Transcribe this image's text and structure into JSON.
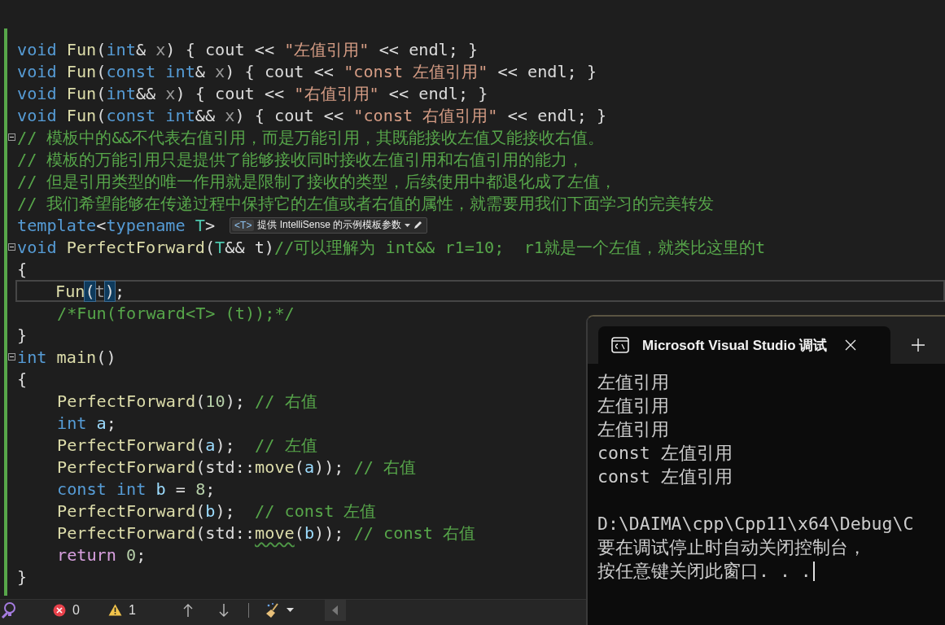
{
  "editor": {
    "lines": [
      {
        "indent": false,
        "fold": false,
        "current": false,
        "tokens": [
          {
            "kind": "kw",
            "text": "void"
          },
          {
            "kind": "func",
            "text": " Fun"
          },
          {
            "kind": "plain",
            "text": "("
          },
          {
            "kind": "kw",
            "text": "int"
          },
          {
            "kind": "plain",
            "text": "& "
          },
          {
            "kind": "unused",
            "text": "x"
          },
          {
            "kind": "plain",
            "text": ") { cout << "
          },
          {
            "kind": "string",
            "text": "\"左值引用\""
          },
          {
            "kind": "plain",
            "text": " << endl; }"
          }
        ]
      },
      {
        "indent": false,
        "fold": false,
        "current": false,
        "tokens": [
          {
            "kind": "kw",
            "text": "void"
          },
          {
            "kind": "func",
            "text": " Fun"
          },
          {
            "kind": "plain",
            "text": "("
          },
          {
            "kind": "kw",
            "text": "const int"
          },
          {
            "kind": "plain",
            "text": "& "
          },
          {
            "kind": "unused",
            "text": "x"
          },
          {
            "kind": "plain",
            "text": ") { cout << "
          },
          {
            "kind": "string",
            "text": "\"const 左值引用\""
          },
          {
            "kind": "plain",
            "text": " << endl; }"
          }
        ]
      },
      {
        "indent": false,
        "fold": false,
        "current": false,
        "tokens": [
          {
            "kind": "kw",
            "text": "void"
          },
          {
            "kind": "func",
            "text": " Fun"
          },
          {
            "kind": "plain",
            "text": "("
          },
          {
            "kind": "kw",
            "text": "int"
          },
          {
            "kind": "plain",
            "text": "&& "
          },
          {
            "kind": "unused",
            "text": "x"
          },
          {
            "kind": "plain",
            "text": ") { cout << "
          },
          {
            "kind": "string",
            "text": "\"右值引用\""
          },
          {
            "kind": "plain",
            "text": " << endl; }"
          }
        ]
      },
      {
        "indent": false,
        "fold": false,
        "current": false,
        "tokens": [
          {
            "kind": "kw",
            "text": "void"
          },
          {
            "kind": "func",
            "text": " Fun"
          },
          {
            "kind": "plain",
            "text": "("
          },
          {
            "kind": "kw",
            "text": "const int"
          },
          {
            "kind": "plain",
            "text": "&& "
          },
          {
            "kind": "unused",
            "text": "x"
          },
          {
            "kind": "plain",
            "text": ") { cout << "
          },
          {
            "kind": "string",
            "text": "\"const 右值引用\""
          },
          {
            "kind": "plain",
            "text": " << endl; }"
          }
        ]
      },
      {
        "indent": false,
        "fold": true,
        "current": false,
        "tokens": [
          {
            "kind": "comment",
            "text": "// 模板中的&&不代表右值引用，而是万能引用，其既能接收左值又能接收右值。"
          }
        ]
      },
      {
        "indent": false,
        "fold": false,
        "current": false,
        "tokens": [
          {
            "kind": "comment",
            "text": "// 模板的万能引用只是提供了能够接收同时接收左值引用和右值引用的能力，"
          }
        ]
      },
      {
        "indent": false,
        "fold": false,
        "current": false,
        "tokens": [
          {
            "kind": "comment",
            "text": "// 但是引用类型的唯一作用就是限制了接收的类型，后续使用中都退化成了左值，"
          }
        ]
      },
      {
        "indent": false,
        "fold": false,
        "current": false,
        "tokens": [
          {
            "kind": "comment",
            "text": "// 我们希望能够在传递过程中保持它的左值或者右值的属性，就需要用我们下面学习的完美转发"
          }
        ]
      },
      {
        "indent": false,
        "fold": false,
        "current": false,
        "tokens": [
          {
            "kind": "kw",
            "text": "template"
          },
          {
            "kind": "plain",
            "text": "<"
          },
          {
            "kind": "kw",
            "text": "typename"
          },
          {
            "kind": "type",
            "text": " T"
          },
          {
            "kind": "plain",
            "text": ">"
          }
        ],
        "hint": {
          "tag": "<T>",
          "text": "提供 IntelliSense 的示例模板参数"
        }
      },
      {
        "indent": false,
        "fold": true,
        "current": false,
        "tokens": [
          {
            "kind": "kw",
            "text": "void"
          },
          {
            "kind": "func",
            "text": " PerfectForward"
          },
          {
            "kind": "plain",
            "text": "("
          },
          {
            "kind": "type",
            "text": "T"
          },
          {
            "kind": "plain",
            "text": "&& t)"
          },
          {
            "kind": "comment",
            "text": "//可以理解为 int&& r1=10;  r1就是一个左值，就类比这里的t"
          }
        ]
      },
      {
        "indent": false,
        "fold": false,
        "current": false,
        "tokens": [
          {
            "kind": "plain",
            "text": "{"
          }
        ]
      },
      {
        "indent": true,
        "fold": false,
        "current": true,
        "tokens": [
          {
            "kind": "func",
            "text": "Fun"
          },
          {
            "kind": "match",
            "text": "("
          },
          {
            "kind": "unused",
            "text": "t"
          },
          {
            "kind": "match",
            "text": ")"
          },
          {
            "kind": "plain",
            "text": ";"
          }
        ]
      },
      {
        "indent": true,
        "fold": false,
        "current": false,
        "tokens": [
          {
            "kind": "comment",
            "text": "/*Fun(forward<T> (t));*/"
          }
        ]
      },
      {
        "indent": false,
        "fold": false,
        "current": false,
        "tokens": [
          {
            "kind": "plain",
            "text": "}"
          }
        ]
      },
      {
        "indent": false,
        "fold": true,
        "current": false,
        "tokens": [
          {
            "kind": "kw",
            "text": "int"
          },
          {
            "kind": "func",
            "text": " main"
          },
          {
            "kind": "plain",
            "text": "()"
          }
        ]
      },
      {
        "indent": false,
        "fold": false,
        "current": false,
        "tokens": [
          {
            "kind": "plain",
            "text": "{"
          }
        ]
      },
      {
        "indent": true,
        "fold": false,
        "current": false,
        "tokens": [
          {
            "kind": "func",
            "text": "PerfectForward"
          },
          {
            "kind": "plain",
            "text": "("
          },
          {
            "kind": "number",
            "text": "10"
          },
          {
            "kind": "plain",
            "text": "); "
          },
          {
            "kind": "comment",
            "text": "// 右值"
          }
        ]
      },
      {
        "indent": true,
        "fold": false,
        "current": false,
        "tokens": [
          {
            "kind": "kw",
            "text": "int"
          },
          {
            "kind": "param",
            "text": " a"
          },
          {
            "kind": "plain",
            "text": ";"
          }
        ]
      },
      {
        "indent": true,
        "fold": false,
        "current": false,
        "tokens": [
          {
            "kind": "func",
            "text": "PerfectForward"
          },
          {
            "kind": "plain",
            "text": "("
          },
          {
            "kind": "param",
            "text": "a"
          },
          {
            "kind": "plain",
            "text": ");  "
          },
          {
            "kind": "comment",
            "text": "// 左值"
          }
        ]
      },
      {
        "indent": true,
        "fold": false,
        "current": false,
        "tokens": [
          {
            "kind": "func",
            "text": "PerfectForward"
          },
          {
            "kind": "plain",
            "text": "(std::"
          },
          {
            "kind": "func",
            "text": "move"
          },
          {
            "kind": "plain",
            "text": "("
          },
          {
            "kind": "param",
            "text": "a"
          },
          {
            "kind": "plain",
            "text": ")); "
          },
          {
            "kind": "comment",
            "text": "// 右值"
          }
        ]
      },
      {
        "indent": true,
        "fold": false,
        "current": false,
        "tokens": [
          {
            "kind": "kw",
            "text": "const int"
          },
          {
            "kind": "param",
            "text": " b"
          },
          {
            "kind": "plain",
            "text": " = "
          },
          {
            "kind": "number",
            "text": "8"
          },
          {
            "kind": "plain",
            "text": ";"
          }
        ]
      },
      {
        "indent": true,
        "fold": false,
        "current": false,
        "tokens": [
          {
            "kind": "func",
            "text": "PerfectForward"
          },
          {
            "kind": "plain",
            "text": "("
          },
          {
            "kind": "param",
            "text": "b"
          },
          {
            "kind": "plain",
            "text": ");  "
          },
          {
            "kind": "comment",
            "text": "// const 左值"
          }
        ]
      },
      {
        "indent": true,
        "fold": false,
        "current": false,
        "tokens": [
          {
            "kind": "func",
            "text": "PerfectForward"
          },
          {
            "kind": "plain",
            "text": "(std::"
          },
          {
            "kind": "warn",
            "text": "move"
          },
          {
            "kind": "plain",
            "text": "("
          },
          {
            "kind": "param",
            "text": "b"
          },
          {
            "kind": "plain",
            "text": ")); "
          },
          {
            "kind": "comment",
            "text": "// const 右值"
          }
        ]
      },
      {
        "indent": true,
        "fold": false,
        "current": false,
        "tokens": [
          {
            "kind": "control",
            "text": "return"
          },
          {
            "kind": "number",
            "text": " 0"
          },
          {
            "kind": "plain",
            "text": ";"
          }
        ]
      },
      {
        "indent": false,
        "fold": false,
        "current": false,
        "tokens": [
          {
            "kind": "plain",
            "text": "}"
          }
        ]
      }
    ]
  },
  "status_bar": {
    "errors": "0",
    "warnings": "1"
  },
  "console": {
    "tab_title": "Microsoft Visual Studio 调试",
    "blocks": [
      {
        "lines": [
          "左值引用",
          "左值引用",
          "左值引用",
          "const 左值引用",
          "const 左值引用"
        ]
      },
      {
        "lines": [
          "D:\\DAIMA\\cpp\\Cpp11\\x64\\Debug\\C",
          "要在调试停止时自动关闭控制台，",
          "按任意键关闭此窗口. . ."
        ]
      }
    ]
  }
}
